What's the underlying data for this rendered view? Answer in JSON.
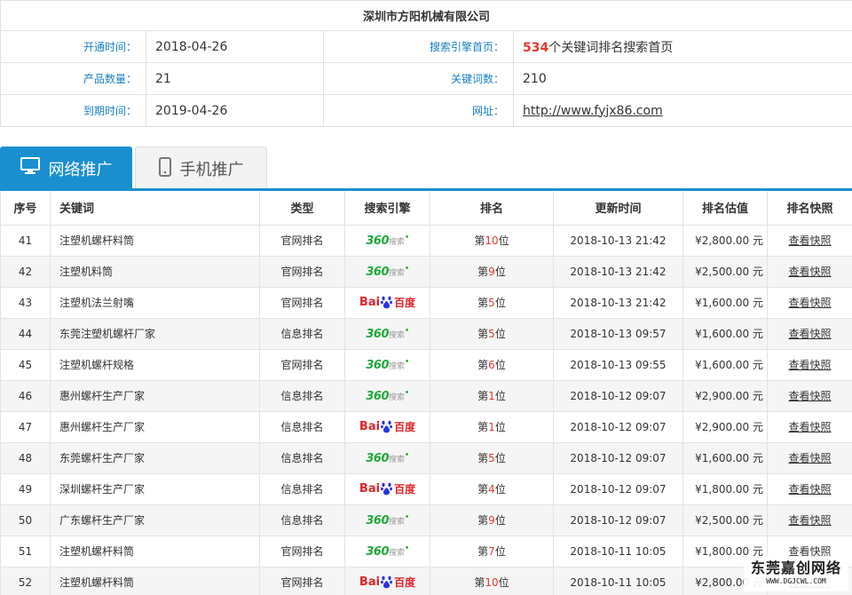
{
  "company": "深圳市方阳机械有限公司",
  "info": {
    "open_label": "开通时间：",
    "open_value": "2018-04-26",
    "engine_home_label": "搜索引擎首页：",
    "engine_home_count": "534",
    "engine_home_suffix": "个关键词排名搜索首页",
    "product_label": "产品数量：",
    "product_value": "21",
    "keyword_label": "关键词数：",
    "keyword_value": "210",
    "expire_label": "到期时间：",
    "expire_value": "2019-04-26",
    "url_label": "网址：",
    "url_value": "http://www.fyjx86.com"
  },
  "tabs": [
    {
      "label": "网络推广",
      "icon": "desktop-icon",
      "active": true
    },
    {
      "label": "手机推广",
      "icon": "mobile-icon",
      "active": false
    }
  ],
  "table": {
    "headers": [
      "序号",
      "关键词",
      "类型",
      "搜索引擎",
      "排名",
      "更新时间",
      "排名估值",
      "排名快照"
    ],
    "rows": [
      {
        "no": "41",
        "kw": "注塑机螺杆料筒",
        "type": "官网排名",
        "engine": "360",
        "rank_pre": "第",
        "rank": "10",
        "rank_suf": "位",
        "time": "2018-10-13 21:42",
        "price": "¥2,800.00 元",
        "snap": "查看快照"
      },
      {
        "no": "42",
        "kw": "注塑机料筒",
        "type": "官网排名",
        "engine": "360",
        "rank_pre": "第",
        "rank": "9",
        "rank_suf": "位",
        "time": "2018-10-13 21:42",
        "price": "¥2,500.00 元",
        "snap": "查看快照"
      },
      {
        "no": "43",
        "kw": "注塑机法兰射嘴",
        "type": "官网排名",
        "engine": "baidu",
        "rank_pre": "第",
        "rank": "5",
        "rank_suf": "位",
        "time": "2018-10-13 21:42",
        "price": "¥1,600.00 元",
        "snap": "查看快照"
      },
      {
        "no": "44",
        "kw": "东莞注塑机螺杆厂家",
        "type": "信息排名",
        "engine": "360",
        "rank_pre": "第",
        "rank": "5",
        "rank_suf": "位",
        "time": "2018-10-13 09:57",
        "price": "¥1,600.00 元",
        "snap": "查看快照"
      },
      {
        "no": "45",
        "kw": "注塑机螺杆规格",
        "type": "官网排名",
        "engine": "360",
        "rank_pre": "第",
        "rank": "6",
        "rank_suf": "位",
        "time": "2018-10-13 09:55",
        "price": "¥1,600.00 元",
        "snap": "查看快照"
      },
      {
        "no": "46",
        "kw": "惠州螺杆生产厂家",
        "type": "信息排名",
        "engine": "360",
        "rank_pre": "第",
        "rank": "1",
        "rank_suf": "位",
        "time": "2018-10-12 09:07",
        "price": "¥2,900.00 元",
        "snap": "查看快照"
      },
      {
        "no": "47",
        "kw": "惠州螺杆生产厂家",
        "type": "信息排名",
        "engine": "baidu",
        "rank_pre": "第",
        "rank": "1",
        "rank_suf": "位",
        "time": "2018-10-12 09:07",
        "price": "¥2,900.00 元",
        "snap": "查看快照"
      },
      {
        "no": "48",
        "kw": "东莞螺杆生产厂家",
        "type": "信息排名",
        "engine": "360",
        "rank_pre": "第",
        "rank": "5",
        "rank_suf": "位",
        "time": "2018-10-12 09:07",
        "price": "¥1,600.00 元",
        "snap": "查看快照"
      },
      {
        "no": "49",
        "kw": "深圳螺杆生产厂家",
        "type": "信息排名",
        "engine": "baidu",
        "rank_pre": "第",
        "rank": "4",
        "rank_suf": "位",
        "time": "2018-10-12 09:07",
        "price": "¥1,800.00 元",
        "snap": "查看快照"
      },
      {
        "no": "50",
        "kw": "广东螺杆生产厂家",
        "type": "信息排名",
        "engine": "360",
        "rank_pre": "第",
        "rank": "9",
        "rank_suf": "位",
        "time": "2018-10-12 09:07",
        "price": "¥2,500.00 元",
        "snap": "查看快照"
      },
      {
        "no": "51",
        "kw": "注塑机螺杆料筒",
        "type": "官网排名",
        "engine": "360",
        "rank_pre": "第",
        "rank": "7",
        "rank_suf": "位",
        "time": "2018-10-11 10:05",
        "price": "¥1,800.00 元",
        "snap": "查看快照"
      },
      {
        "no": "52",
        "kw": "注塑机螺杆料筒",
        "type": "官网排名",
        "engine": "baidu",
        "rank_pre": "第",
        "rank": "10",
        "rank_suf": "位",
        "time": "2018-10-11 10:05",
        "price": "¥2,800.00 元",
        "snap": "查看快照"
      }
    ]
  },
  "logos": {
    "s360_main": "360",
    "s360_sub": "搜索",
    "baidu_a": "Bai",
    "baidu_b": "百度"
  },
  "watermark": {
    "cn": "东莞嘉创网络",
    "en": "WWW.DGJCWL.COM"
  },
  "colors": {
    "accent": "#1a8fcf",
    "label": "#1a7ec2",
    "highlight": "#e03c31",
    "green360": "#22a83c",
    "baidu": "#e0242a"
  }
}
